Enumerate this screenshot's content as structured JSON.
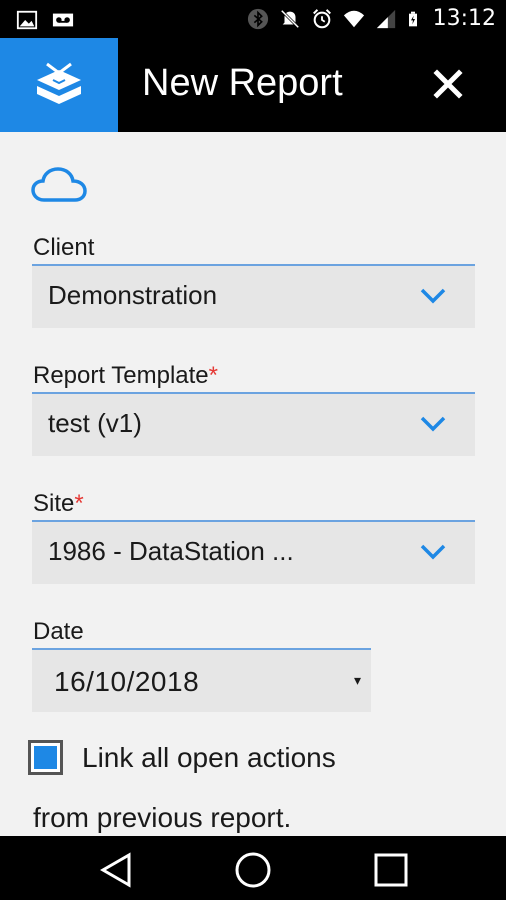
{
  "status_bar": {
    "time": "13:12",
    "icons": [
      "image-icon",
      "voicemail-icon",
      "bluetooth-icon",
      "mute-icon",
      "alarm-icon",
      "wifi-icon",
      "signal-icon",
      "battery-icon"
    ]
  },
  "app_bar": {
    "title": "New Report",
    "logo_icon": "layers-logo-icon",
    "close_icon": "close-icon",
    "accent_color": "#1e88e5"
  },
  "form": {
    "sync_icon": "cloud-icon",
    "client": {
      "label": "Client",
      "value": "Demonstration"
    },
    "template": {
      "label": "Report Template",
      "required_mark": "*",
      "value": "test (v1)"
    },
    "site": {
      "label": "Site",
      "required_mark": "*",
      "value": "1986 - DataStation ..."
    },
    "date": {
      "label": "Date",
      "value": "16/10/2018",
      "arrow": "▾"
    },
    "link_actions": {
      "label_line1": "Link all open actions",
      "label_line2": "from previous report.",
      "checked": true
    }
  },
  "nav_bar": {
    "icons": [
      "back-icon",
      "home-icon",
      "recents-icon"
    ]
  }
}
